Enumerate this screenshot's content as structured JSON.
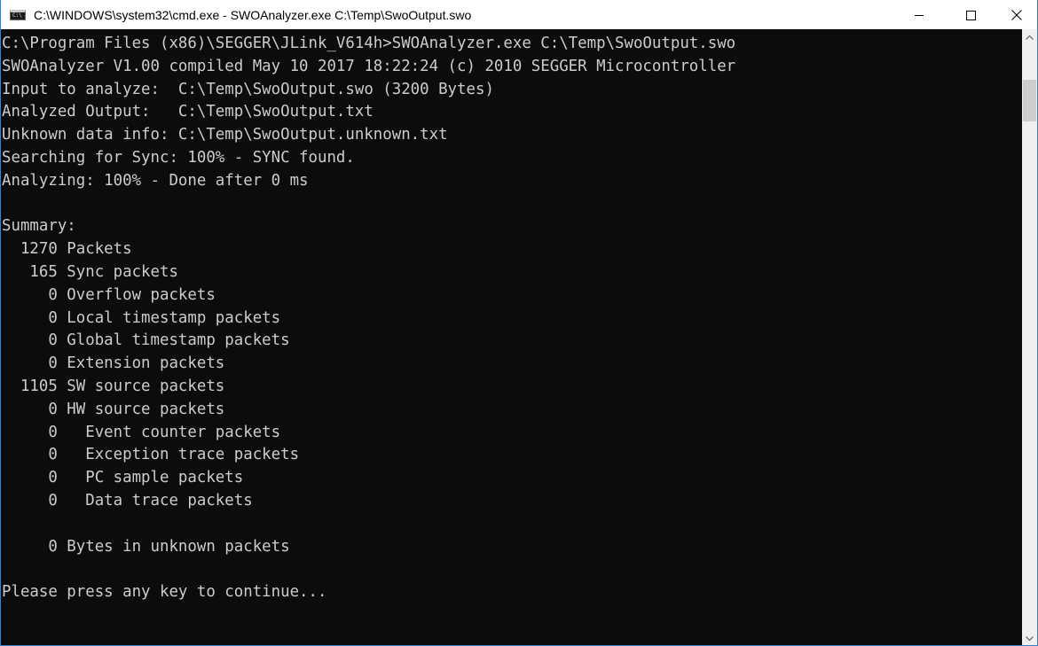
{
  "window": {
    "title": "C:\\WINDOWS\\system32\\cmd.exe - SWOAnalyzer.exe  C:\\Temp\\SwoOutput.swo",
    "app_icon": "cmd-console-icon",
    "icon_text": "C:\\"
  },
  "caption_buttons": {
    "minimize": "minimize-icon",
    "maximize": "maximize-icon",
    "close": "close-icon"
  },
  "console": {
    "background": "#0c0c0c",
    "foreground": "#cccccc",
    "lines": [
      "C:\\Program Files (x86)\\SEGGER\\JLink_V614h>SWOAnalyzer.exe C:\\Temp\\SwoOutput.swo",
      "SWOAnalyzer V1.00 compiled May 10 2017 18:22:24 (c) 2010 SEGGER Microcontroller",
      "Input to analyze:  C:\\Temp\\SwoOutput.swo (3200 Bytes)",
      "Analyzed Output:   C:\\Temp\\SwoOutput.txt",
      "Unknown data info: C:\\Temp\\SwoOutput.unknown.txt",
      "Searching for Sync: 100% - SYNC found.",
      "Analyzing: 100% - Done after 0 ms",
      "",
      "Summary:",
      "  1270 Packets",
      "   165 Sync packets",
      "     0 Overflow packets",
      "     0 Local timestamp packets",
      "     0 Global timestamp packets",
      "     0 Extension packets",
      "  1105 SW source packets",
      "     0 HW source packets",
      "     0   Event counter packets",
      "     0   Exception trace packets",
      "     0   PC sample packets",
      "     0   Data trace packets",
      "",
      "     0 Bytes in unknown packets",
      "",
      "Please press any key to continue..."
    ]
  },
  "scrollbar": {
    "up_arrow": "scroll-up-arrow-icon",
    "down_arrow": "scroll-down-arrow-icon"
  }
}
